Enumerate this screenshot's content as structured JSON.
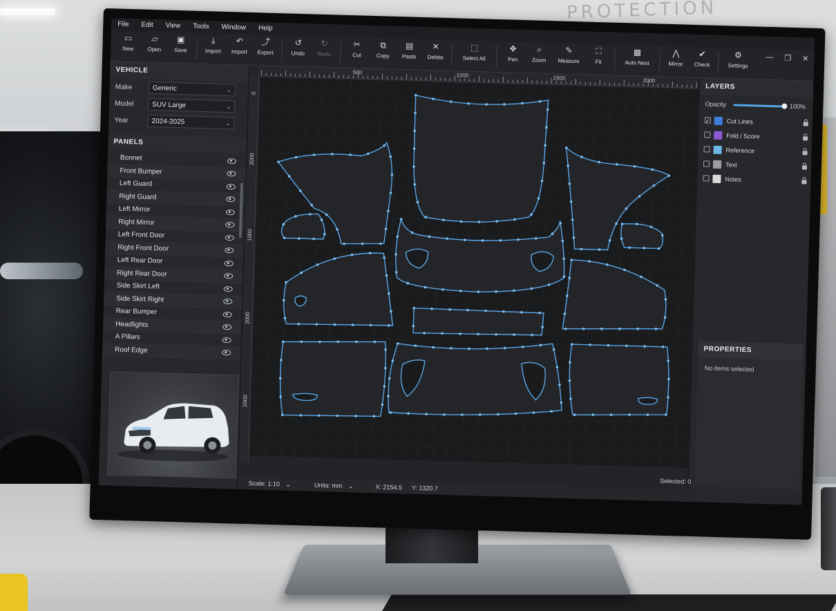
{
  "menu": [
    "File",
    "Edit",
    "View",
    "Tools",
    "Window",
    "Help"
  ],
  "toolbar": [
    {
      "label": "New",
      "icon": "new-file-icon"
    },
    {
      "label": "Open",
      "icon": "folder-open-icon"
    },
    {
      "label": "Save",
      "icon": "save-icon"
    },
    {
      "label": "Import",
      "icon": "import-icon"
    },
    {
      "label": "Import",
      "icon": "import-arrow-icon"
    },
    {
      "label": "Export",
      "icon": "export-icon"
    },
    {
      "label": "Undo",
      "icon": "undo-icon"
    },
    {
      "label": "Redo",
      "icon": "redo-icon",
      "disabled": true
    },
    {
      "label": "Cut",
      "icon": "scissors-icon"
    },
    {
      "label": "Copy",
      "icon": "copy-icon"
    },
    {
      "label": "Paste",
      "icon": "paste-icon"
    },
    {
      "label": "Delete",
      "icon": "delete-icon"
    },
    {
      "label": "Select All",
      "icon": "select-all-icon"
    },
    {
      "label": "Pan",
      "icon": "pan-icon"
    },
    {
      "label": "Zoom",
      "icon": "zoom-icon"
    },
    {
      "label": "Measure",
      "icon": "measure-icon"
    },
    {
      "label": "Fit",
      "icon": "fit-icon"
    },
    {
      "label": "Auto Nest",
      "icon": "auto-nest-icon"
    },
    {
      "label": "Mirror",
      "icon": "mirror-icon"
    },
    {
      "label": "Check",
      "icon": "check-icon"
    },
    {
      "label": "Settings",
      "icon": "gear-icon"
    }
  ],
  "vehicle": {
    "title": "VEHICLE",
    "make_label": "Make",
    "make_value": "Generic",
    "model_label": "Model",
    "model_value": "SUV Large",
    "year_label": "Year",
    "year_value": "2024-2025"
  },
  "panels": {
    "title": "PANELS",
    "items": [
      "Bonnet",
      "Front Bumper",
      "Left Guard",
      "Right Guard",
      "Left Mirror",
      "Right Mirror",
      "Left Front Door",
      "Right Front Door",
      "Left Rear Door",
      "Right Rear Door",
      "Side Skirt Left",
      "Side Skirt Right",
      "Rear Bumper",
      "Headlights",
      "A Pillars",
      "Roof Edge"
    ]
  },
  "ruler": {
    "h": [
      "500",
      "1000",
      "1500",
      "2000"
    ],
    "v": [
      "0",
      "2000",
      "1000",
      "2000",
      "2000"
    ]
  },
  "layers": {
    "title": "LAYERS",
    "opacity_label": "Opacity",
    "opacity_value": "100%",
    "opacity": 1.0,
    "items": [
      {
        "name": "Cut Lines",
        "color": "#3d7fd9",
        "checked": true
      },
      {
        "name": "Fold / Score",
        "color": "#8a5ad6",
        "checked": false
      },
      {
        "name": "Reference",
        "color": "#6db7e3",
        "checked": false
      },
      {
        "name": "Text",
        "color": "#9b9da1",
        "checked": false
      },
      {
        "name": "Notes",
        "color": "#d8dadc",
        "checked": false
      }
    ]
  },
  "properties": {
    "title": "PROPERTIES",
    "empty": "No items selected"
  },
  "status": {
    "scale": "Scale:  1:10",
    "units": "Units:  mm",
    "x": "X:  2154.5",
    "y": "Y:  1320.7",
    "selected": "Selected: 0"
  },
  "colors": {
    "accent": "#58a6e8",
    "canvas": "#1a1b1d",
    "panel": "#26282b"
  },
  "background": {
    "wall_sign": "PROTECTION"
  }
}
